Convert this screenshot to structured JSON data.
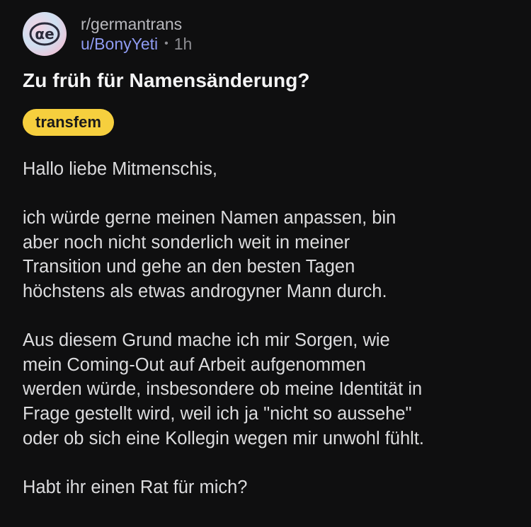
{
  "post": {
    "subreddit": "r/germantrans",
    "username": "u/BonyYeti",
    "separator": "•",
    "time": "1h",
    "title": "Zu früh für Namensänderung?",
    "flair": "transfem",
    "paragraphs": [
      "Hallo liebe Mitmenschis,",
      "ich würde gerne meinen Namen anpassen, bin\naber noch nicht sonderlich weit in meiner\nTransition und gehe an den besten Tagen\nhöchstens als etwas androgyner Mann durch.",
      "Aus diesem Grund mache ich mir Sorgen, wie\nmein Coming-Out auf Arbeit aufgenommen\nwerden würde, insbesondere ob meine Identität in\nFrage gestellt wird, weil ich ja \"nicht so aussehe\"\noder ob sich eine Kollegin wegen mir unwohl fühlt.",
      "Habt ihr einen Rat für mich?"
    ]
  },
  "colors": {
    "background": "#0f0f10",
    "flair_bg": "#f6cf3e",
    "username": "#8f9bf2"
  },
  "icons": {
    "subreddit_avatar": "subreddit-avatar-icon"
  }
}
